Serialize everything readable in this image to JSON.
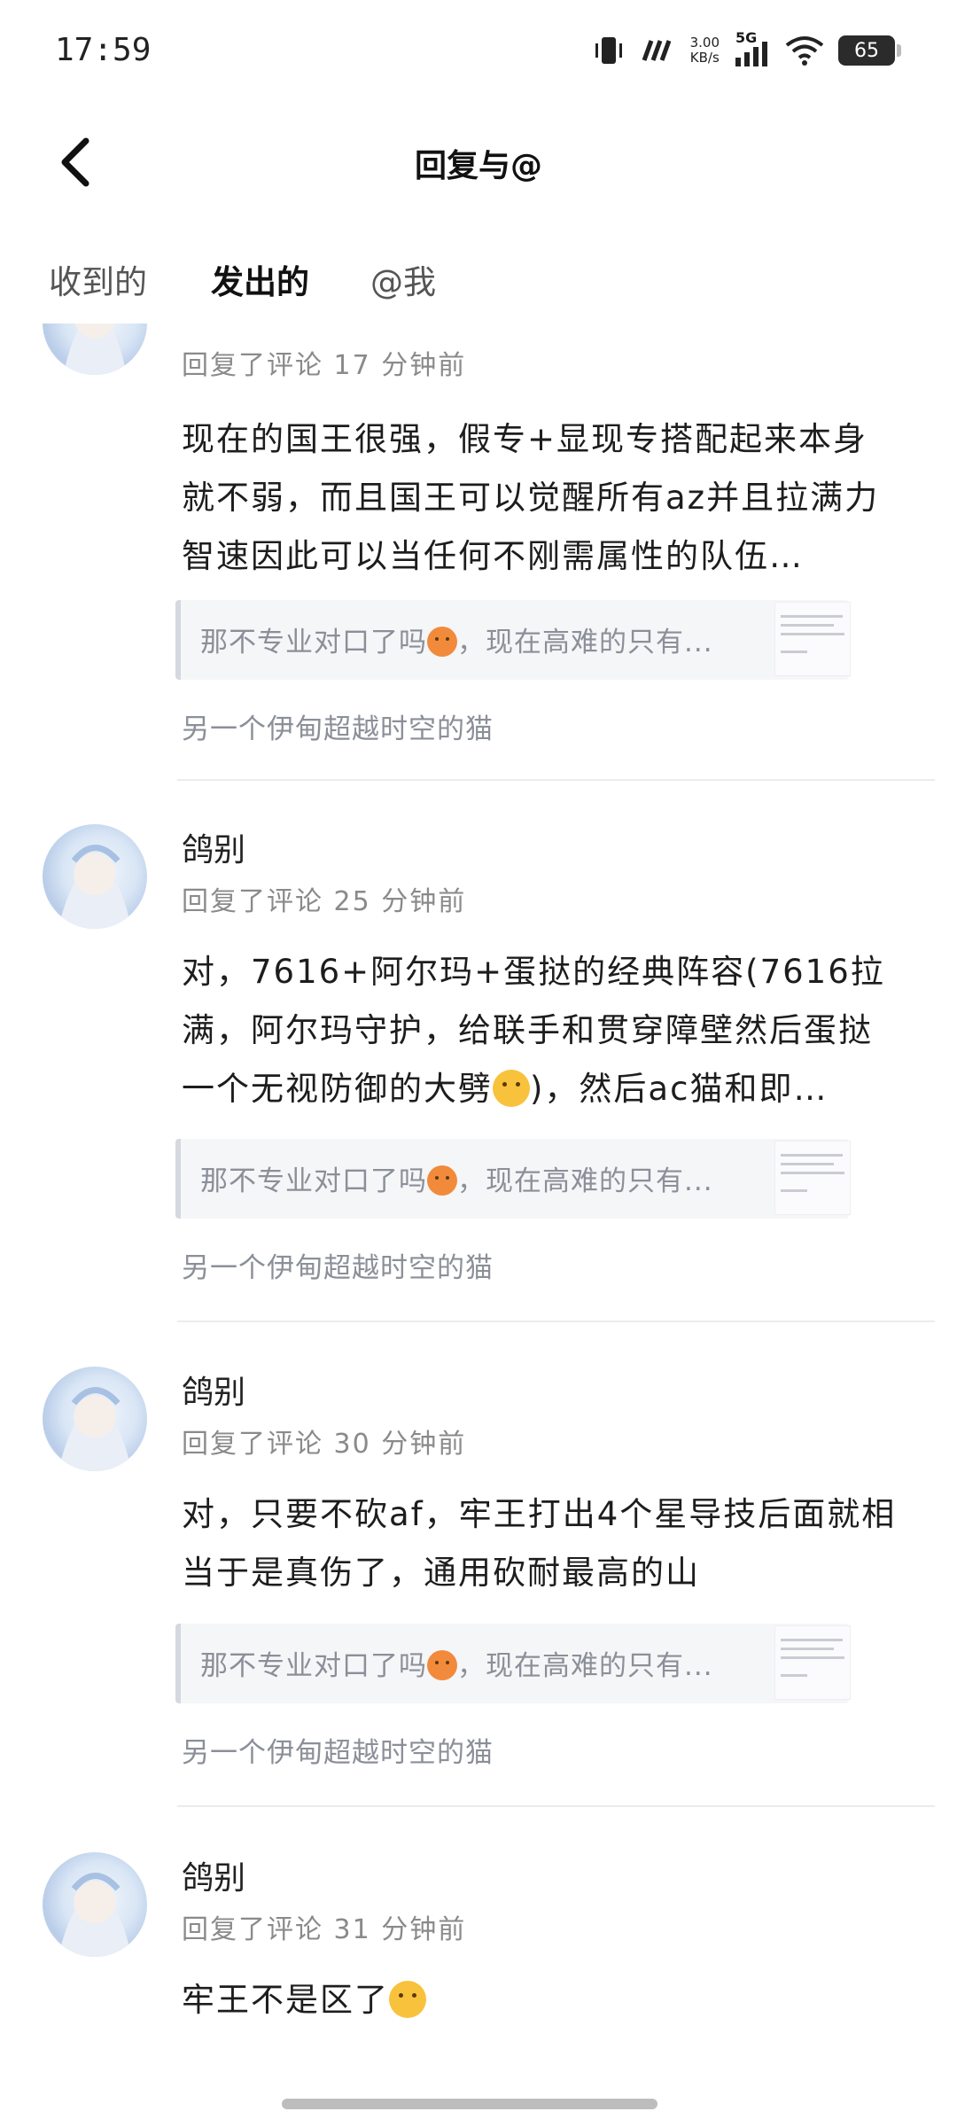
{
  "status_bar": {
    "time": "17:59",
    "net_speed_value": "3.00",
    "net_speed_unit": "KB/s",
    "network": "5G",
    "battery": "65"
  },
  "header": {
    "title": "回复与@"
  },
  "tabs": [
    {
      "label": "收到的"
    },
    {
      "label": "发出的"
    },
    {
      "label": "@我"
    }
  ],
  "items": [
    {
      "username": "",
      "meta": "回复了评论 17 分钟前",
      "content": "现在的国王很强，假专+显现专搭配起来本身就不弱，而且国王可以觉醒所有az并且拉满力智速因此可以当任何不刚需属性的队伍…",
      "quote": "那不专业对口了吗",
      "quote_suffix": "，现在高难的只有...",
      "target": "另一个伊甸超越时空的猫"
    },
    {
      "username": "鸽别",
      "meta": "回复了评论 25 分钟前",
      "content": "对，7616+阿尔玛+蛋挞的经典阵容(7616拉满，阿尔玛守护，给联手和贯穿障壁然后蛋挞一个无视防御的大劈",
      "content_suffix": ")，然后ac猫和即…",
      "quote": "那不专业对口了吗",
      "quote_suffix": "，现在高难的只有...",
      "target": "另一个伊甸超越时空的猫"
    },
    {
      "username": "鸽别",
      "meta": "回复了评论 30 分钟前",
      "content": "对，只要不砍af，牢王打出4个星导技后面就相当于是真伤了，通用砍耐最高的山",
      "quote": "那不专业对口了吗",
      "quote_suffix": "，现在高难的只有...",
      "target": "另一个伊甸超越时空的猫"
    },
    {
      "username": "鸽别",
      "meta": "回复了评论 31 分钟前",
      "content": "牢王不是区了"
    }
  ],
  "icons": {
    "back": "chevron-left-icon",
    "vibrate": "vibrate-icon",
    "signal": "signal-bars-icon",
    "wifi": "wifi-icon",
    "battery": "battery-icon"
  },
  "colors": {
    "accent": "#23c7b8",
    "secondary_text": "#8b8f98",
    "quote_bg": "#f5f6f8"
  }
}
